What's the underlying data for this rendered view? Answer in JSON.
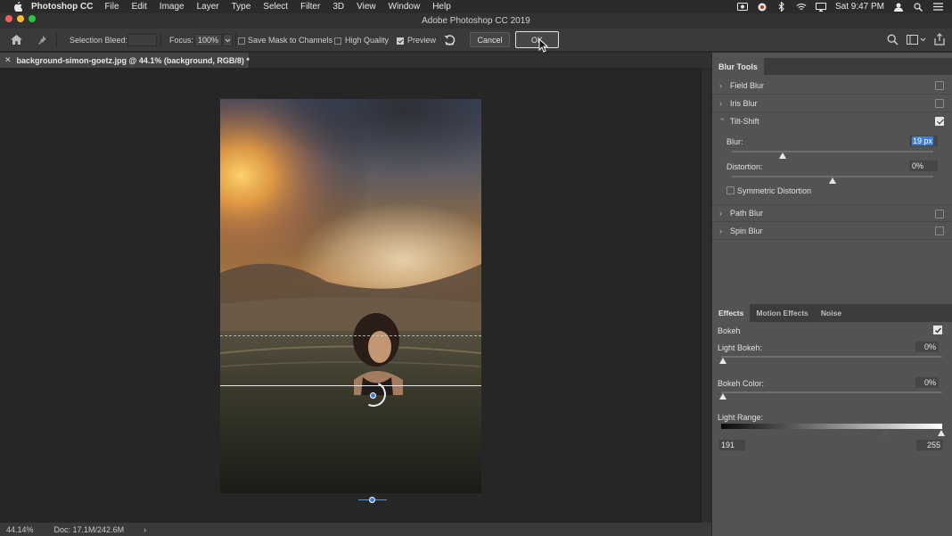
{
  "menubar": {
    "app_name": "Photoshop CC",
    "items": [
      "File",
      "Edit",
      "Image",
      "Layer",
      "Type",
      "Select",
      "Filter",
      "3D",
      "View",
      "Window",
      "Help"
    ],
    "clock": "Sat 9:47 PM"
  },
  "window": {
    "title": "Adobe Photoshop CC 2019"
  },
  "options_bar": {
    "selection_bleed_label": "Selection Bleed:",
    "selection_bleed_value": "",
    "focus_label": "Focus:",
    "focus_value": "100%",
    "save_mask_label": "Save Mask to Channels",
    "save_mask_checked": false,
    "high_quality_label": "High Quality",
    "high_quality_checked": false,
    "preview_label": "Preview",
    "preview_checked": true,
    "cancel_label": "Cancel",
    "ok_label": "OK"
  },
  "document": {
    "tab_title": "background-simon-goetz.jpg @ 44.1% (background, RGB/8) *"
  },
  "status_bar": {
    "zoom": "44.14%",
    "doc_size": "Doc: 17.1M/242.6M"
  },
  "blur_tools": {
    "title": "Blur Tools",
    "field_blur": {
      "label": "Field Blur",
      "checked": false
    },
    "iris_blur": {
      "label": "Iris Blur",
      "checked": false
    },
    "tilt_shift": {
      "label": "Tilt-Shift",
      "checked": true,
      "blur_label": "Blur:",
      "blur_value": "19 px",
      "blur_level": 0.25,
      "distortion_label": "Distortion:",
      "distortion_value": "0%",
      "distortion_level": 0.5,
      "symmetric_label": "Symmetric Distortion",
      "symmetric_checked": false
    },
    "path_blur": {
      "label": "Path Blur",
      "checked": false
    },
    "spin_blur": {
      "label": "Spin Blur",
      "checked": false
    }
  },
  "effects": {
    "tabs": [
      "Effects",
      "Motion Effects",
      "Noise"
    ],
    "bokeh_label": "Bokeh",
    "bokeh_checked": true,
    "light_bokeh_label": "Light Bokeh:",
    "light_bokeh_value": "0%",
    "bokeh_color_label": "Bokeh Color:",
    "bokeh_color_value": "0%",
    "light_range_label": "Light Range:",
    "light_range_low": "191",
    "light_range_high": "255"
  },
  "colors": {
    "panel_bg": "#535353",
    "accent_blue": "#3d7fd6"
  }
}
